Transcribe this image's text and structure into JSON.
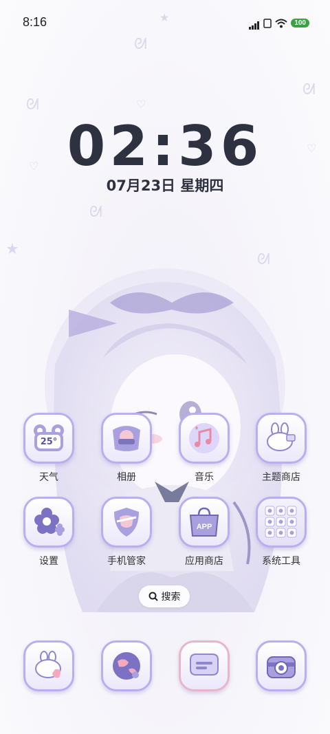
{
  "status_bar": {
    "time": "8:16",
    "battery": "100"
  },
  "clock": {
    "time": "02:36",
    "date": "07月23日 星期四"
  },
  "apps": [
    {
      "name": "weather",
      "label": "天气",
      "icon": "weather-frog-icon",
      "badge": "25°"
    },
    {
      "name": "gallery",
      "label": "相册",
      "icon": "gallery-icon"
    },
    {
      "name": "music",
      "label": "音乐",
      "icon": "music-note-icon"
    },
    {
      "name": "theme-store",
      "label": "主题商店",
      "icon": "bunny-brush-icon"
    },
    {
      "name": "settings",
      "label": "设置",
      "icon": "gear-flower-icon"
    },
    {
      "name": "phone-manager",
      "label": "手机管家",
      "icon": "shield-icon"
    },
    {
      "name": "app-store",
      "label": "应用商店",
      "icon": "app-bag-icon",
      "badge": "APP"
    },
    {
      "name": "system-tools",
      "label": "系统工具",
      "icon": "folder-grid-icon"
    }
  ],
  "search": {
    "label": "搜索"
  },
  "dock": [
    {
      "name": "dock-phone",
      "icon": "bunny-phone-icon"
    },
    {
      "name": "dock-browser",
      "icon": "planet-icon"
    },
    {
      "name": "dock-messages",
      "icon": "message-icon"
    },
    {
      "name": "dock-camera",
      "icon": "camera-icon"
    }
  ],
  "colors": {
    "accent": "#b8aef0",
    "clock_text": "#2e3140",
    "battery_green": "#3aa243"
  }
}
